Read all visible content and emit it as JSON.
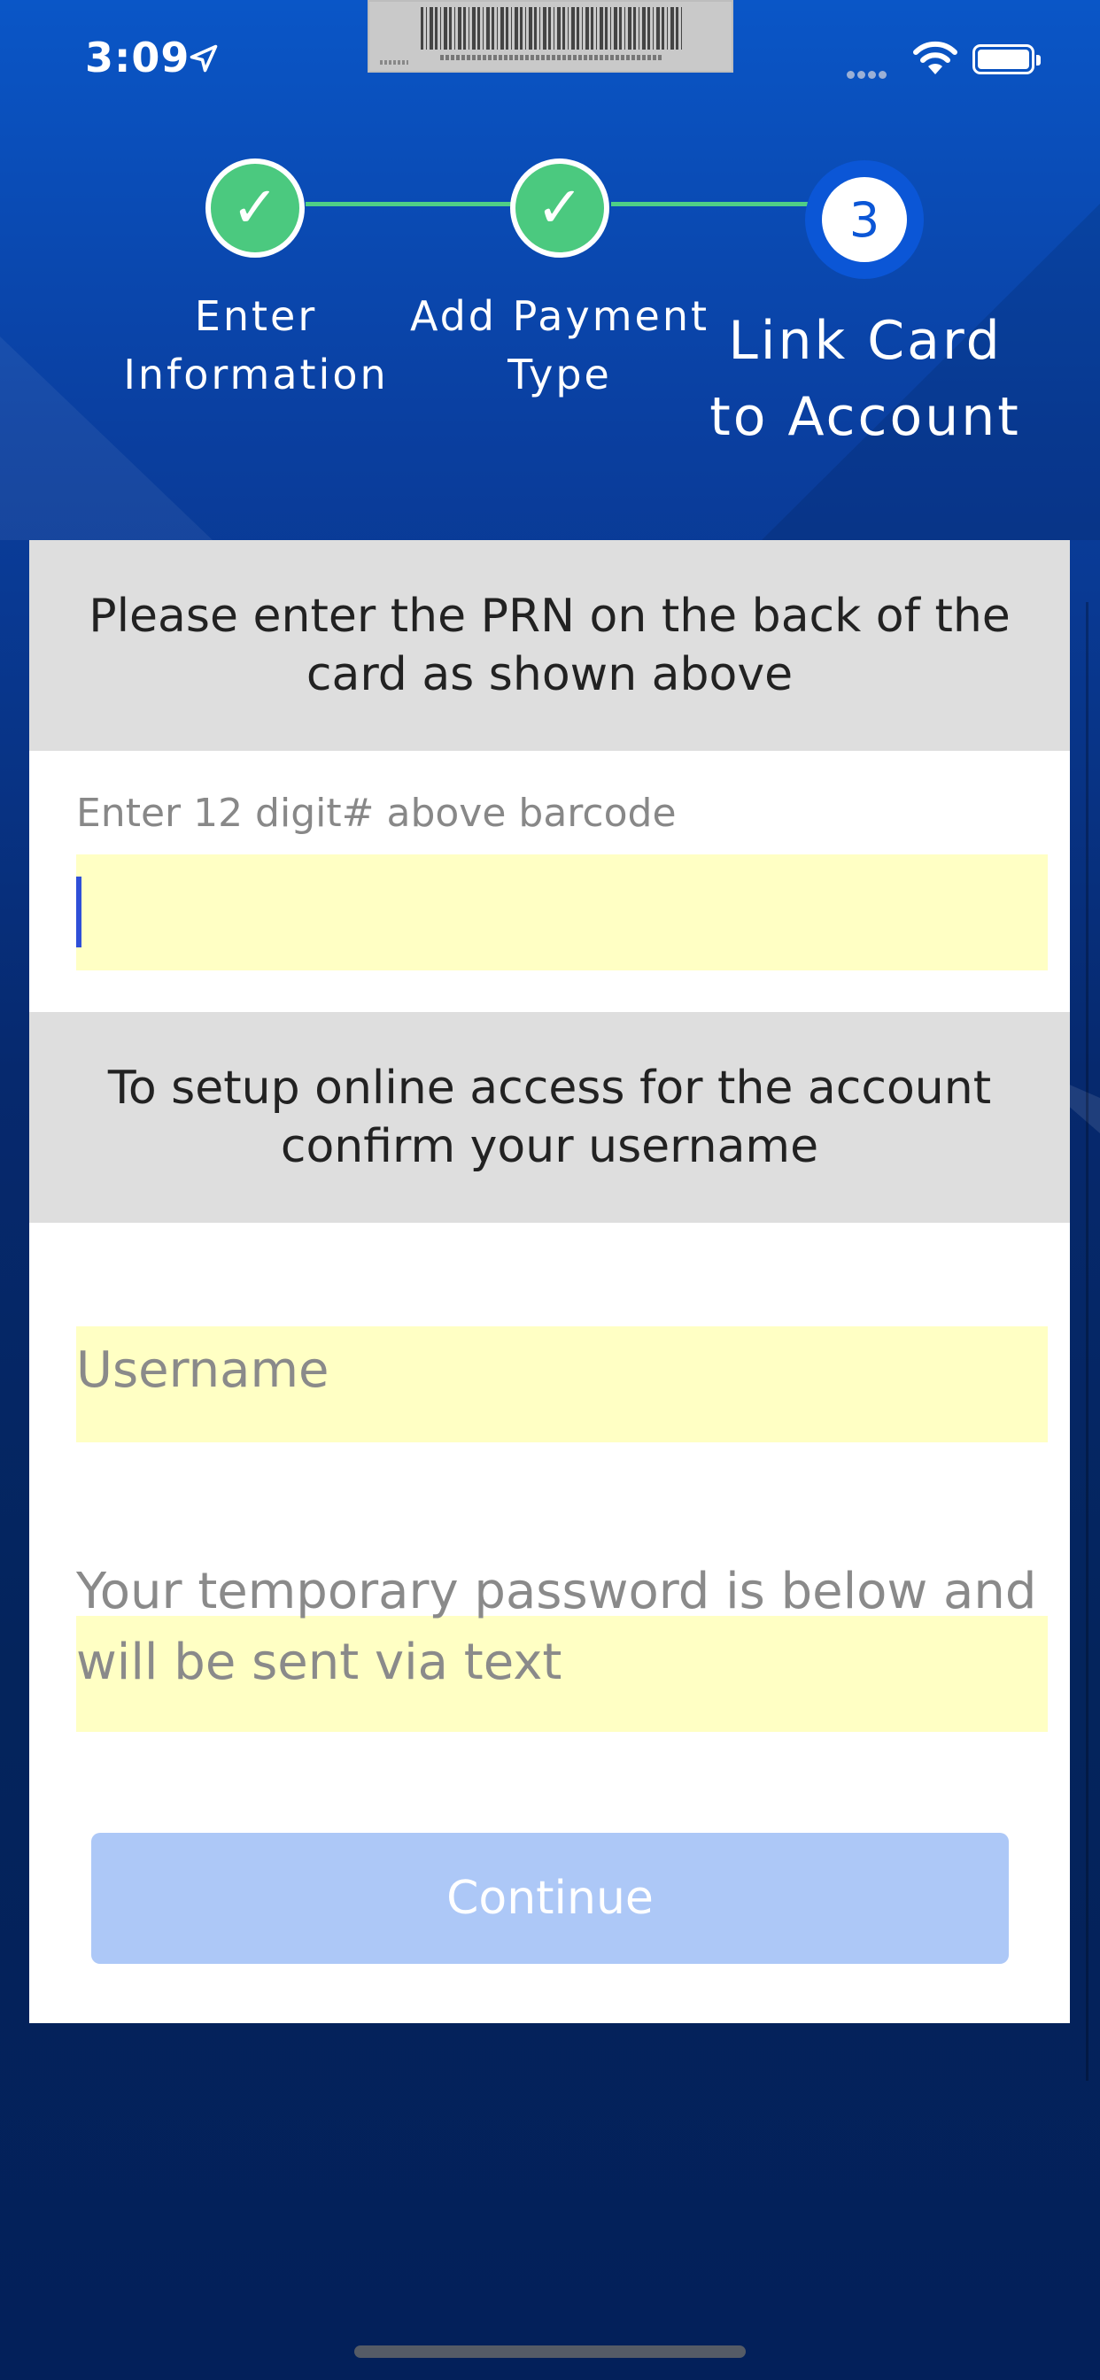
{
  "status_bar": {
    "time": "3:09"
  },
  "stepper": {
    "steps": [
      {
        "label": "Enter\nInformation",
        "state": "done",
        "icon": "checkmark-icon",
        "glyph": "✓"
      },
      {
        "label": "Add Payment\nType",
        "state": "done",
        "icon": "checkmark-icon",
        "glyph": "✓"
      },
      {
        "label": "Link Card\nto Account",
        "state": "active",
        "number": "3"
      }
    ]
  },
  "prn_section": {
    "header": "Please enter the PRN on the back of the card as shown above",
    "field_label": "Enter 12 digit# above barcode",
    "value": ""
  },
  "online_access_section": {
    "header": "To setup online access for the account confirm your username",
    "username_placeholder": "Username",
    "temp_password_text": "Your temporary password is below and will be sent via text"
  },
  "actions": {
    "continue_label": "Continue"
  },
  "colors": {
    "accent_blue": "#0b56d6",
    "step_done_green": "#4bc97f",
    "input_yellow": "#ffffc4",
    "disabled_button": "#adc8f7"
  }
}
